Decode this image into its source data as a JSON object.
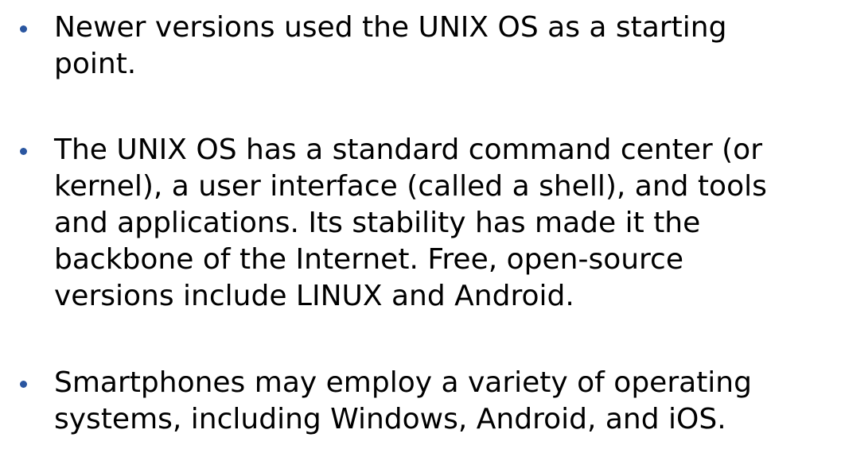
{
  "bullet_color": "#2a56a0",
  "bullets": [
    {
      "lines": [
        "Newer versions used the UNIX OS as a starting",
        "point."
      ]
    },
    {
      "lines": [
        "The UNIX OS has a standard command center (or",
        "kernel), a user interface (called a shell), and tools",
        "and applications.  Its stability has made it the",
        "backbone of the Internet.  Free, open-source",
        "versions include LINUX and Android."
      ]
    },
    {
      "lines": [
        "Smartphones may employ a variety of operating",
        "systems, including Windows, Android, and iOS."
      ]
    }
  ]
}
